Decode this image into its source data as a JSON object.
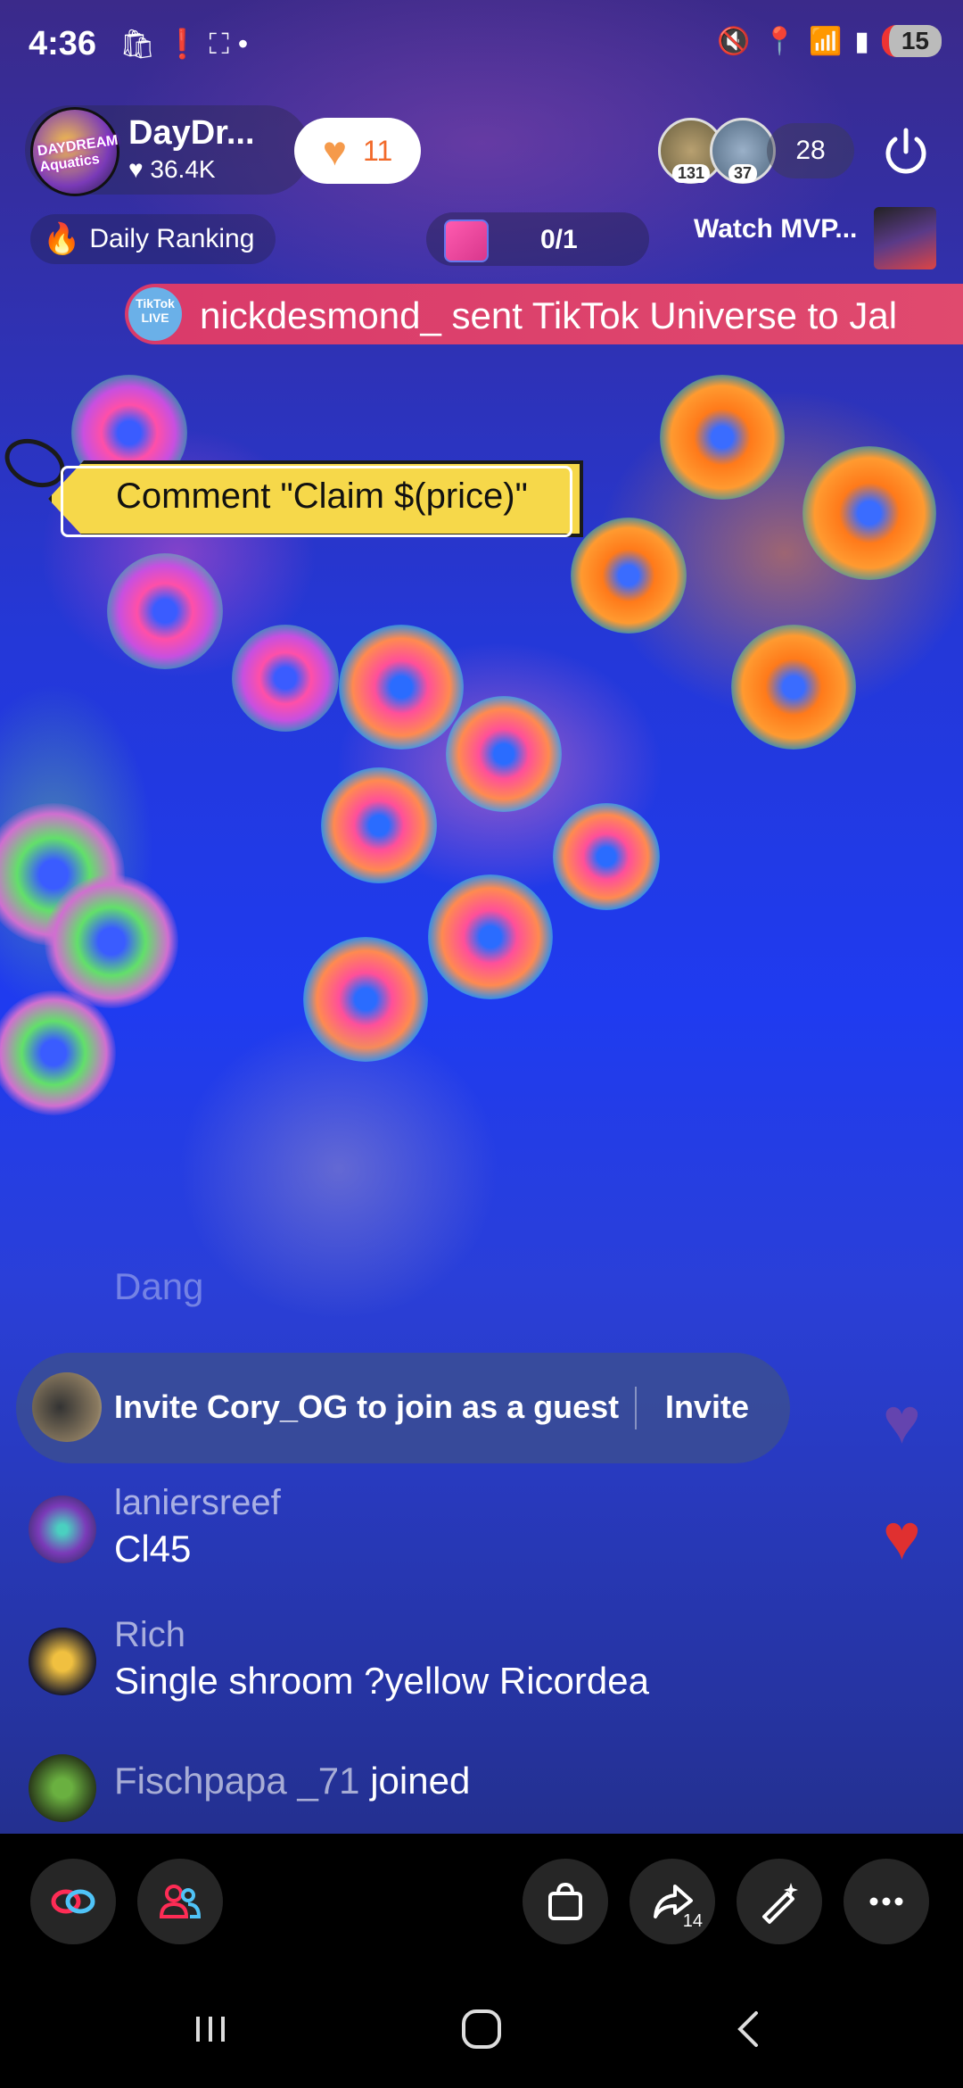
{
  "status_bar": {
    "time": "4:36",
    "battery": "15",
    "icons_left": [
      "shop-icon",
      "alert-icon",
      "screen-capture-icon",
      "dot-icon"
    ],
    "icons_right": [
      "mute-icon",
      "location-icon",
      "wifi-icon",
      "signal-icon"
    ]
  },
  "host": {
    "name": "DayDr...",
    "likes": "36.4K",
    "avatar_logo_text": "DAYDREAM Aquatics"
  },
  "like_button": {
    "count": "11"
  },
  "viewers": {
    "badges": [
      "131",
      "37"
    ],
    "count": "28"
  },
  "ranking": {
    "label": "Daily Ranking"
  },
  "goal": {
    "progress": "0/1"
  },
  "mvp": {
    "label": "Watch MVP..."
  },
  "gift_banner": {
    "badge": "TikTok LIVE",
    "text": "nickdesmond_ sent TikTok Universe to Jal"
  },
  "claim_tag": {
    "text": "Comment \"Claim $(price)\""
  },
  "faded_comment": {
    "text": "Dang"
  },
  "guest_invite": {
    "text": "Invite Cory_OG to join as a guest",
    "button": "Invite"
  },
  "comments": [
    {
      "user": "laniersreef",
      "message": "Cl45"
    },
    {
      "user": "Rich",
      "message": "Single shroom ?yellow Ricordea"
    },
    {
      "user": "Fischpapa _71",
      "message": "joined"
    }
  ],
  "toolbar": {
    "share_count": "14"
  },
  "colors": {
    "accent": "#fe2c55",
    "gift_banner": "#d93a6a",
    "claim_tag": "#f6d84a",
    "like_orange": "#f59a4b",
    "heart_red": "#e03030"
  }
}
